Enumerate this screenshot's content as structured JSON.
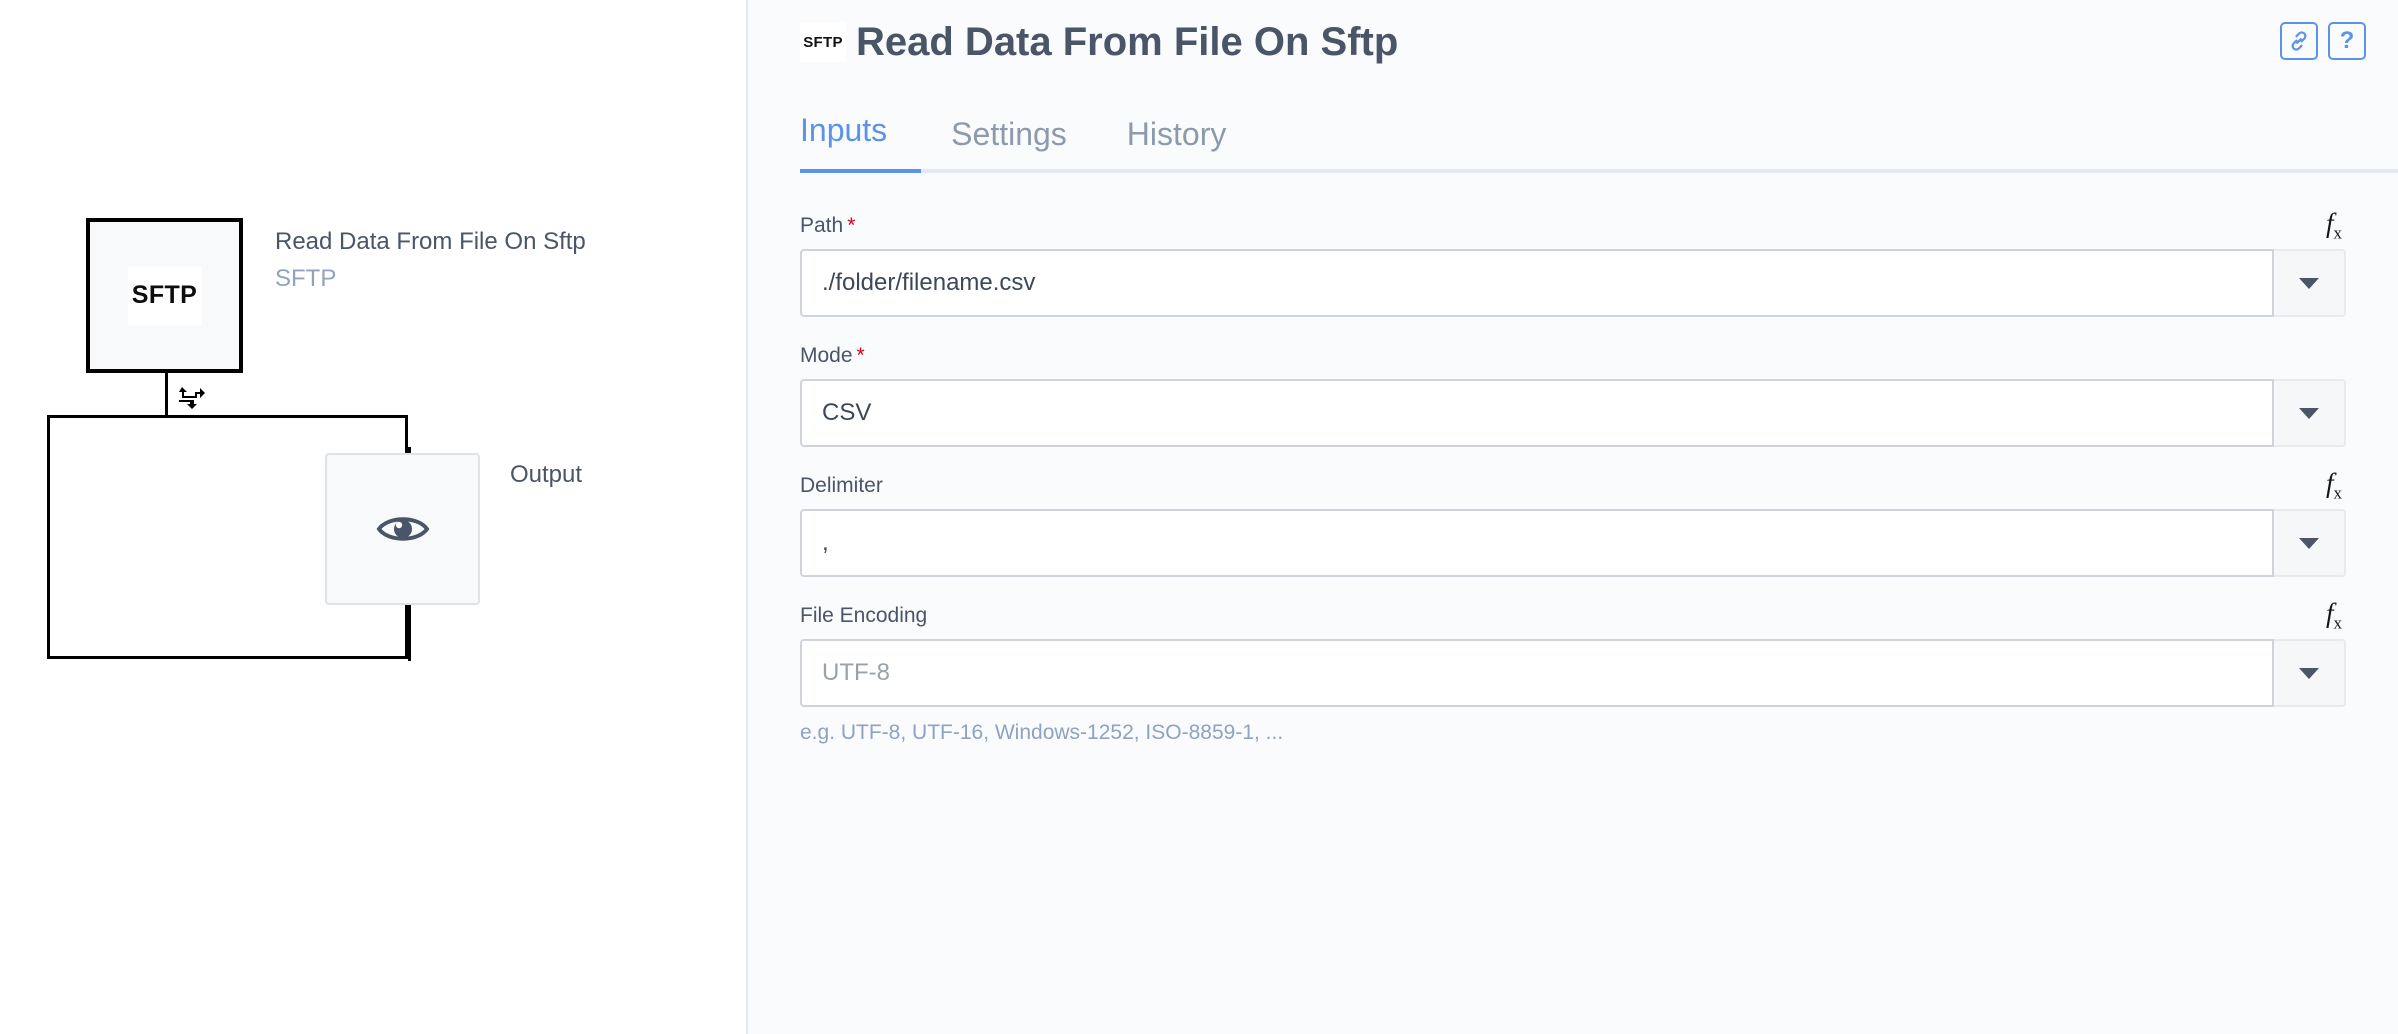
{
  "canvas": {
    "sftp_node": {
      "badge_label": "SFTP",
      "title": "Read Data From File On Sftp",
      "subtitle": "SFTP",
      "loop_icon": "loop-repeat-icon"
    },
    "output_node": {
      "label": "Output",
      "icon": "eye-icon"
    }
  },
  "header": {
    "badge_label": "SFTP",
    "title": "Read Data From File On Sftp",
    "actions": [
      {
        "name": "link-icon",
        "label": ""
      },
      {
        "name": "help-icon",
        "label": "?"
      }
    ]
  },
  "tabs": [
    {
      "label": "Inputs",
      "active": true
    },
    {
      "label": "Settings",
      "active": false
    },
    {
      "label": "History",
      "active": false
    }
  ],
  "fields": [
    {
      "label": "Path",
      "required_marker": "*",
      "value": "./folder/filename.csv",
      "is_placeholder": false,
      "has_fx": true,
      "hint": ""
    },
    {
      "label": "Mode",
      "required_marker": "*",
      "value": "CSV",
      "is_placeholder": false,
      "has_fx": false,
      "hint": ""
    },
    {
      "label": "Delimiter",
      "required_marker": "",
      "value": ",",
      "is_placeholder": false,
      "has_fx": true,
      "hint": ""
    },
    {
      "label": "File Encoding",
      "required_marker": "",
      "value": "UTF-8",
      "is_placeholder": true,
      "has_fx": true,
      "hint": "e.g. UTF-8, UTF-16, Windows-1252, ISO-8859-1, ..."
    }
  ],
  "colors": {
    "accent": "#5b93e8",
    "text": "#4a5568",
    "muted": "#8d9aab",
    "required": "#d0021b",
    "hint": "#8fa2c2",
    "panel_bg": "#fafbfc"
  }
}
